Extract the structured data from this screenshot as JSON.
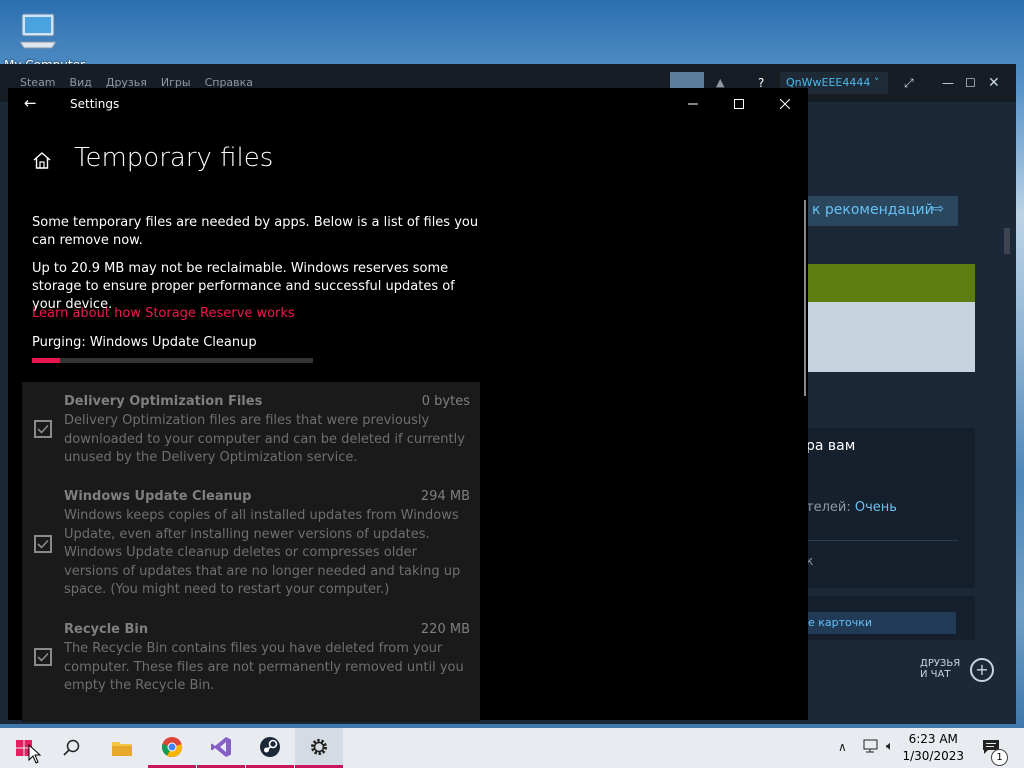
{
  "desktop": {
    "icon_label": "My Computer"
  },
  "steam": {
    "menu": [
      "Steam",
      "Вид",
      "Друзья",
      "Игры",
      "Справка"
    ],
    "username": "QnWwEEE4444 ˅",
    "recommend_btn": "к рекомендаций",
    "text_for_you": "ра вам",
    "text_users_prefix": "телей:",
    "text_users_value": "Очень",
    "text_k": "к",
    "cards_btn": "е карточки",
    "friends_line1": "ДРУЗЬЯ",
    "friends_line2": "И ЧАТ"
  },
  "settings": {
    "window_title": "Settings",
    "page_title": "Temporary files",
    "intro": "Some temporary files are needed by apps. Below is a list of files you can remove now.",
    "reserve_note": "Up to 20.9 MB may not be reclaimable. Windows reserves some storage to ensure proper performance and successful updates of your device.",
    "learn_link": "Learn about how Storage Reserve works",
    "purging_status": "Purging: Windows Update Cleanup",
    "purge_progress": 0.1,
    "items": [
      {
        "title": "Delivery Optimization Files",
        "size": "0 bytes",
        "checked": true,
        "description": "Delivery Optimization files are files that were previously downloaded to your computer and can be deleted if currently unused by the Delivery Optimization service."
      },
      {
        "title": "Windows Update Cleanup",
        "size": "294 MB",
        "checked": true,
        "description": "Windows keeps copies of all installed updates from Windows Update, even after installing newer versions of updates. Windows Update cleanup deletes or compresses older versions of updates that are no longer needed and taking up space. (You might need to restart your computer.)"
      },
      {
        "title": "Recycle Bin",
        "size": "220 MB",
        "checked": true,
        "description": "The Recycle Bin contains files you have deleted from your computer. These files are not permanently removed until you empty the Recycle Bin."
      }
    ]
  },
  "taskbar": {
    "time": "6:23 AM",
    "date": "1/30/2023",
    "notification_count": "1",
    "accent_color": "#c8155b",
    "apps": [
      "start",
      "search",
      "file-explorer",
      "chrome",
      "visual-studio",
      "steam",
      "settings"
    ]
  }
}
